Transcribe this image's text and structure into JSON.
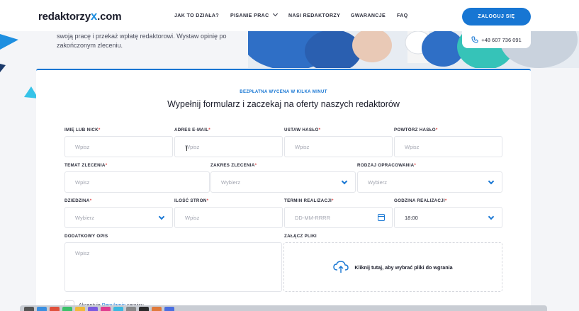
{
  "header": {
    "logo_text": "redaktorzy",
    "logo_x": "x",
    "logo_suffix": ".com",
    "nav": [
      "JAK TO DZIAŁA?",
      "PISANIE PRAC",
      "NASI REDAKTORZY",
      "GWARANCJE",
      "FAQ"
    ],
    "login_label": "ZALOGUJ SIĘ",
    "phone": "+48 607 736 091"
  },
  "hero": {
    "text": "swoją pracę i przekaż wpłatę redaktorowi. Wystaw opinię po zakończonym zleceniu."
  },
  "form": {
    "kicker": "BEZPŁATNA WYCENA W KILKA MINUT",
    "title": "Wypełnij formularz i zaczekaj na oferty naszych redaktorów",
    "required_mark": "*",
    "fields": {
      "nick": {
        "label": "IMIĘ LUB NICK",
        "placeholder": "Wpisz"
      },
      "email": {
        "label": "ADRES E-MAIL",
        "placeholder": "Wpisz"
      },
      "password": {
        "label": "USTAW HASŁO",
        "placeholder": "Wpisz"
      },
      "password_repeat": {
        "label": "POWTÓRZ HASŁO",
        "placeholder": "Wpisz"
      },
      "topic": {
        "label": "TEMAT ZLECENIA",
        "placeholder": "Wpisz"
      },
      "scope": {
        "label": "ZAKRES ZLECENIA",
        "placeholder": "Wybierz"
      },
      "type": {
        "label": "RODZAJ OPRACOWANIA",
        "placeholder": "Wybierz"
      },
      "field": {
        "label": "DZIEDZINA",
        "placeholder": "Wybierz"
      },
      "pages": {
        "label": "ILOŚĆ STRON",
        "placeholder": "Wpisz"
      },
      "deadline": {
        "label": "TERMIN REALIZACJI",
        "placeholder": "DD-MM-RRRR"
      },
      "hour": {
        "label": "GODZINA REALIZACJI",
        "value": "18:00"
      },
      "description": {
        "label": "DODATKOWY OPIS",
        "placeholder": "Wpisz"
      },
      "attachments": {
        "label": "ZAŁĄCZ PLIKI",
        "drop_text": "Kliknij tutaj, aby wybrać pliki do wgrania"
      }
    },
    "accept": {
      "prefix": "Akceptuję ",
      "link": "Regulamin",
      "suffix": " serwisu"
    }
  },
  "colors": {
    "accent": "#1776d3",
    "required": "#e04848",
    "hero_teal": "#36c3b8"
  }
}
